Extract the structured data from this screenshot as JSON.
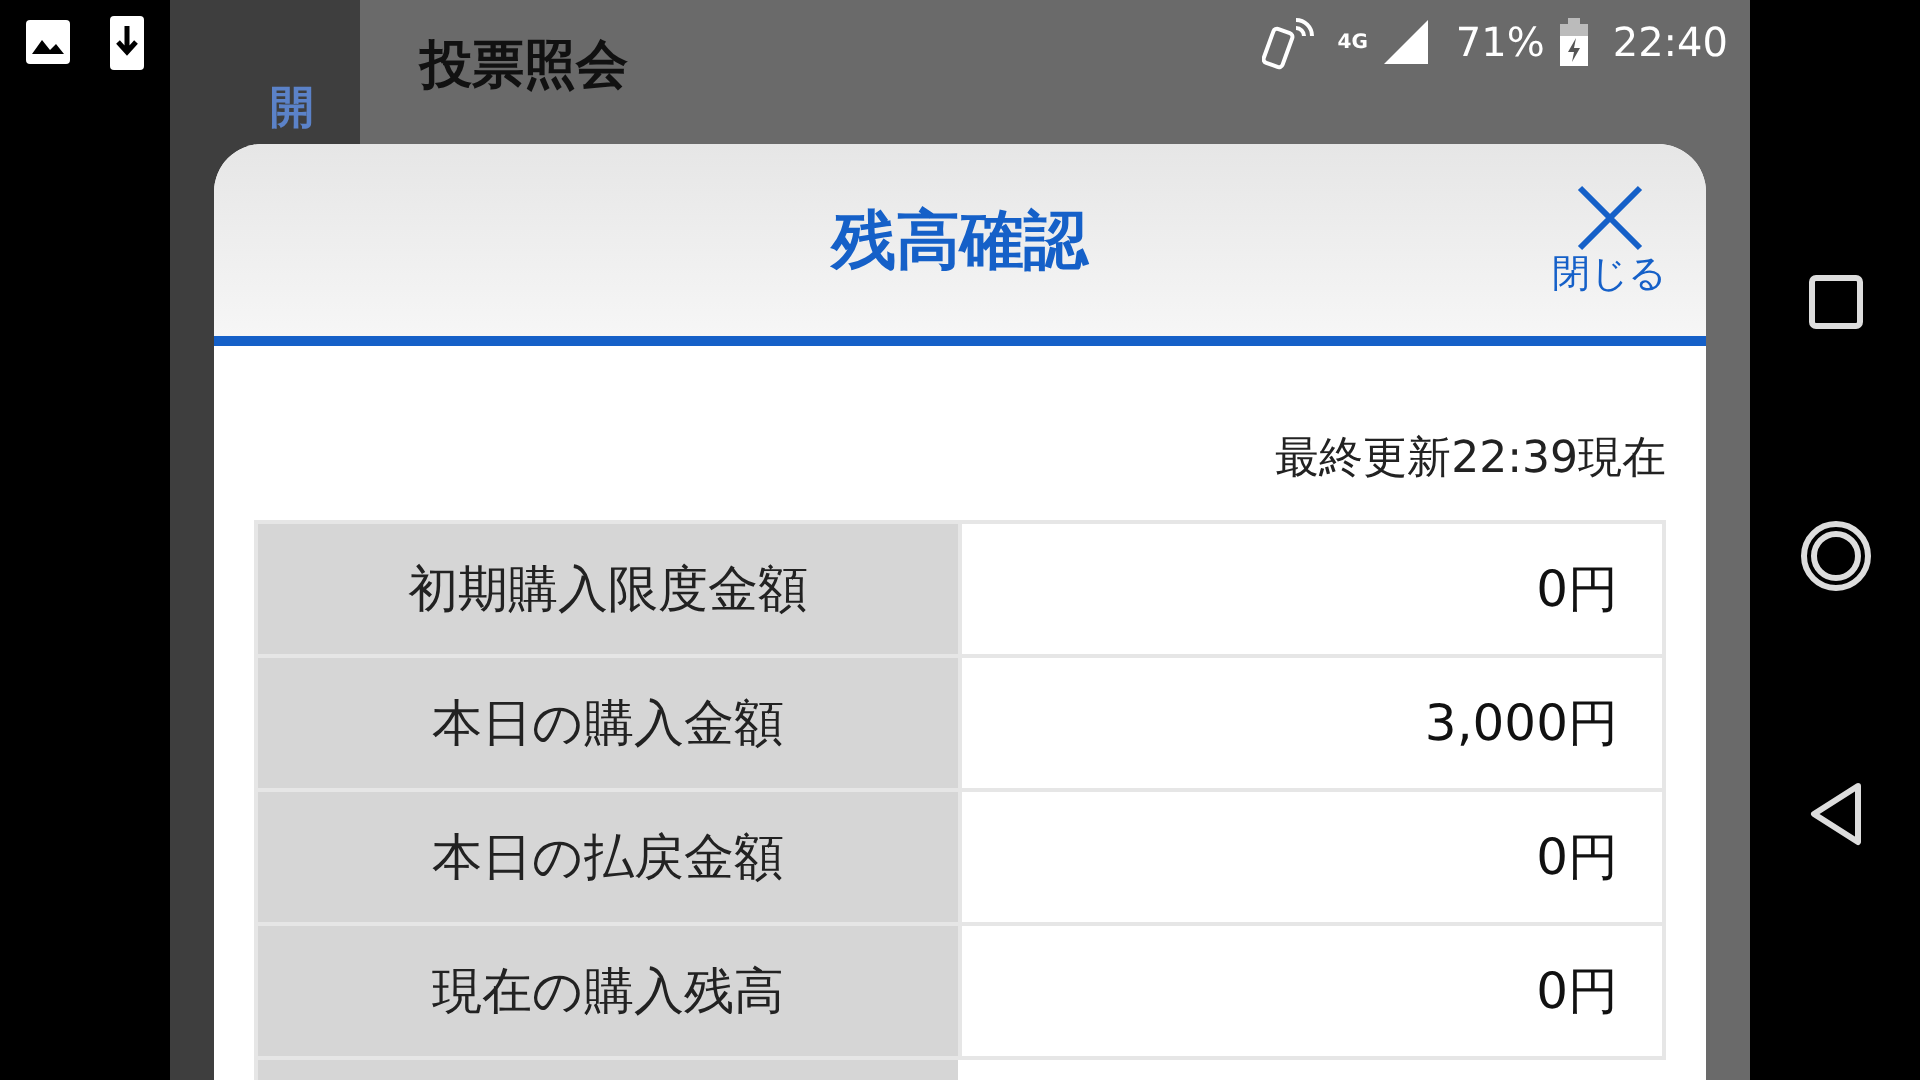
{
  "status_bar": {
    "network": "4G",
    "battery": "71%",
    "time": "22:40"
  },
  "background": {
    "title": "投票照会",
    "heading": "開"
  },
  "dialog": {
    "title": "残高確認",
    "close_label": "閉じる",
    "updated": "最終更新22:39現在",
    "rows": [
      {
        "label": "初期購入限度金額",
        "value": "0円"
      },
      {
        "label": "本日の購入金額",
        "value": "3,000円"
      },
      {
        "label": "本日の払戻金額",
        "value": "0円"
      },
      {
        "label": "現在の購入残高",
        "value": "0円"
      }
    ]
  }
}
